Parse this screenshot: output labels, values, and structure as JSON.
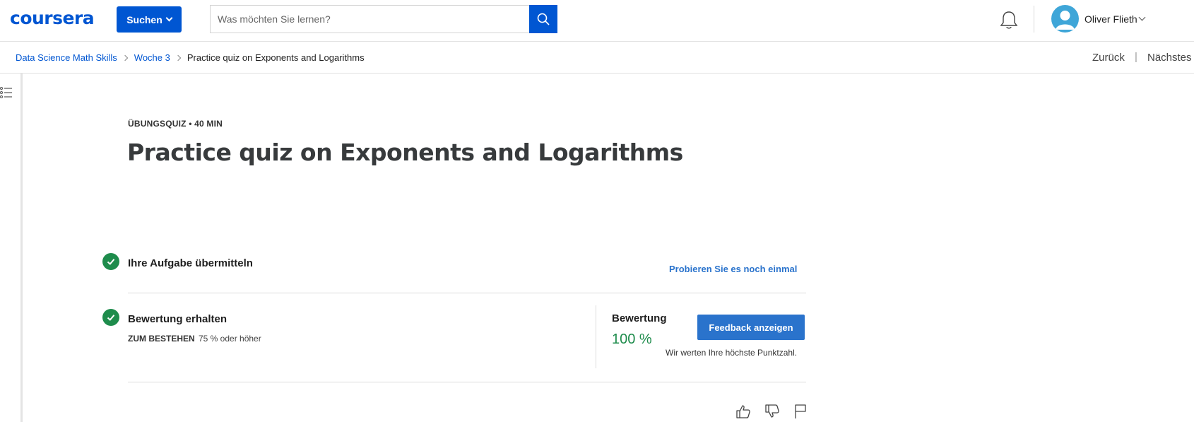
{
  "header": {
    "logo_text": "coursera",
    "search_button_label": "Suchen",
    "search_placeholder": "Was möchten Sie lernen?",
    "search_icon": "search-icon",
    "notification_icon": "bell-icon",
    "user_name": "Oliver Flieth",
    "brand_color": "#0056d2"
  },
  "breadcrumb": {
    "items": [
      "Data Science Math Skills",
      "Woche 3"
    ],
    "current": "Practice quiz on Exponents and Logarithms",
    "back_label": "Zurück",
    "separator": "|",
    "next_label": "Nächstes"
  },
  "main": {
    "kicker": "ÜBUNGSQUIZ • 40 MIN",
    "title": "Practice quiz on Exponents and Logarithms",
    "step1": {
      "title": "Ihre Aufgabe übermitteln",
      "retry_label": "Probieren Sie es noch einmal"
    },
    "step2": {
      "title": "Bewertung erhalten",
      "pass_label": "ZUM BESTEHEN",
      "pass_value": "75 % oder höher",
      "grade_label": "Bewertung",
      "grade_value": "100 %",
      "feedback_button": "Feedback anzeigen",
      "grade_note": "Wir werten Ihre höchste Punktzahl."
    },
    "success_color": "#1e8c4c"
  },
  "rating_icons": [
    "thumbs-up-icon",
    "thumbs-down-icon",
    "flag-icon"
  ]
}
